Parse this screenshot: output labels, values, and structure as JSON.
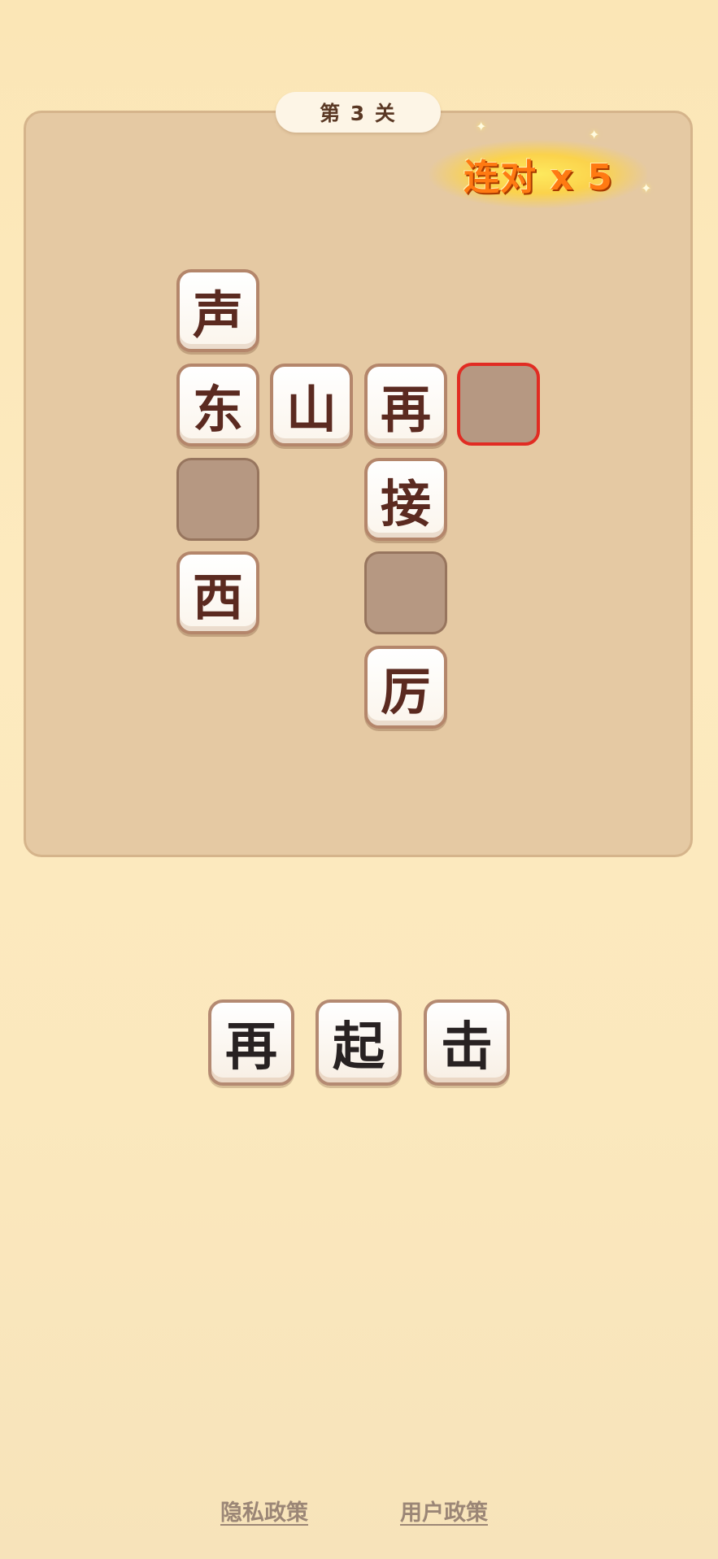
{
  "header": {
    "level_label": "第 3 关",
    "combo_label": "连对 x 5"
  },
  "board": {
    "tiles": {
      "sheng": "声",
      "dong": "东",
      "shan": "山",
      "zai": "再",
      "jie": "接",
      "xi": "西",
      "li": "厉"
    }
  },
  "answers": {
    "options": [
      "再",
      "起",
      "击"
    ]
  },
  "footer": {
    "privacy_label": "隐私政策",
    "user_label": "用户政策"
  },
  "colors": {
    "selected_outline": "#e12c23",
    "empty_tile": "#b69882",
    "board_bg": "#e5c9a3",
    "combo_text": "#ff7a12"
  }
}
